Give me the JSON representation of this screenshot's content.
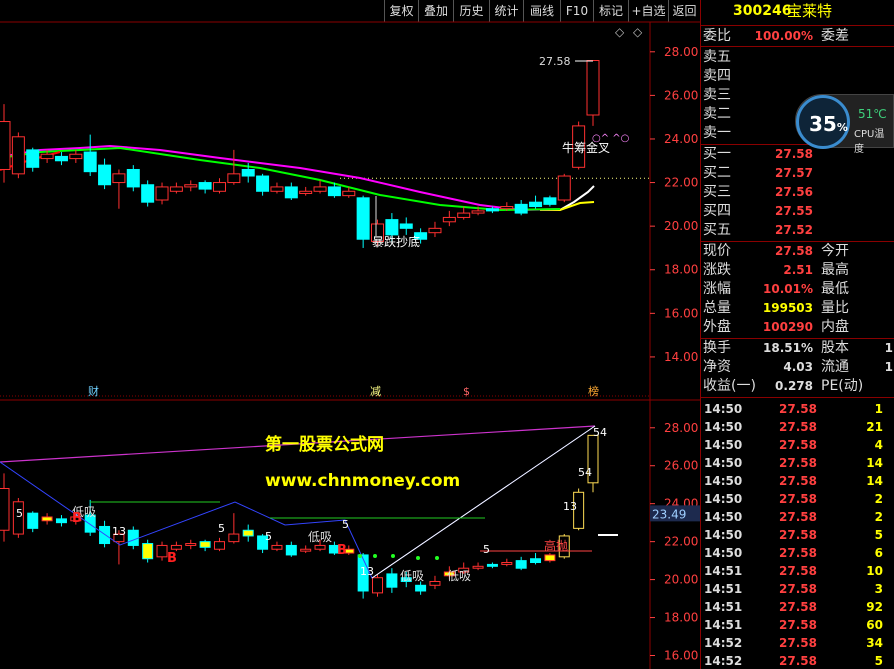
{
  "toolbar": {
    "items": [
      "复权",
      "叠加",
      "历史",
      "统计",
      "画线",
      "F10",
      "标记",
      "+自选",
      "返回"
    ]
  },
  "stock": {
    "code": "300246",
    "name": "宝莱特"
  },
  "colors": {
    "up": "#ff3030",
    "down": "#00ffff",
    "ma5": "#ffffff",
    "ma10": "#ffff00",
    "ma20": "#ff00ff",
    "ma30": "#00ff00",
    "ma60": "#ff0000",
    "axis": "#ff4040",
    "grid": "#8a0000"
  },
  "main_chart": {
    "y_ticks": [
      "28.00",
      "26.00",
      "24.00",
      "22.00",
      "20.00",
      "18.00",
      "16.00",
      "14.00"
    ],
    "ylim": [
      13.4,
      29.0
    ],
    "high_label": "27.58",
    "annotations": [
      "暴跌抄底",
      "牛筹金叉"
    ],
    "pattern_text": "○^ ^○",
    "markers": [
      "财",
      "减",
      "$",
      "榜"
    ]
  },
  "candles": [
    {
      "o": 22.6,
      "c": 24.8,
      "h": 25.6,
      "l": 22.0
    },
    {
      "o": 22.4,
      "c": 24.1,
      "h": 24.3,
      "l": 22.2
    },
    {
      "o": 23.5,
      "c": 22.7,
      "h": 23.6,
      "l": 22.5
    },
    {
      "o": 23.1,
      "c": 23.3,
      "h": 23.5,
      "l": 22.9
    },
    {
      "o": 23.2,
      "c": 23.0,
      "h": 23.4,
      "l": 22.8
    },
    {
      "o": 23.1,
      "c": 23.3,
      "h": 23.5,
      "l": 22.9
    },
    {
      "o": 23.4,
      "c": 22.5,
      "h": 24.2,
      "l": 22.3
    },
    {
      "o": 22.8,
      "c": 21.9,
      "h": 23.1,
      "l": 21.7
    },
    {
      "o": 22.0,
      "c": 22.4,
      "h": 22.6,
      "l": 20.8
    },
    {
      "o": 22.6,
      "c": 21.8,
      "h": 22.8,
      "l": 21.6
    },
    {
      "o": 21.9,
      "c": 21.1,
      "h": 22.1,
      "l": 20.9
    },
    {
      "o": 21.2,
      "c": 21.8,
      "h": 22.0,
      "l": 21.0
    },
    {
      "o": 21.6,
      "c": 21.8,
      "h": 22.0,
      "l": 21.5
    },
    {
      "o": 21.8,
      "c": 21.9,
      "h": 22.1,
      "l": 21.6
    },
    {
      "o": 22.0,
      "c": 21.7,
      "h": 22.1,
      "l": 21.5
    },
    {
      "o": 21.6,
      "c": 22.0,
      "h": 22.2,
      "l": 21.5
    },
    {
      "o": 22.0,
      "c": 22.4,
      "h": 23.5,
      "l": 21.9
    },
    {
      "o": 22.6,
      "c": 22.3,
      "h": 22.9,
      "l": 22.0
    },
    {
      "o": 22.3,
      "c": 21.6,
      "h": 22.4,
      "l": 21.4
    },
    {
      "o": 21.6,
      "c": 21.8,
      "h": 22.0,
      "l": 21.5
    },
    {
      "o": 21.8,
      "c": 21.3,
      "h": 22.0,
      "l": 21.2
    },
    {
      "o": 21.5,
      "c": 21.6,
      "h": 21.8,
      "l": 21.4
    },
    {
      "o": 21.6,
      "c": 21.8,
      "h": 22.1,
      "l": 21.5
    },
    {
      "o": 21.8,
      "c": 21.4,
      "h": 22.0,
      "l": 21.3
    },
    {
      "o": 21.4,
      "c": 21.6,
      "h": 21.8,
      "l": 21.3
    },
    {
      "o": 21.3,
      "c": 19.4,
      "h": 21.4,
      "l": 19.0
    },
    {
      "o": 19.3,
      "c": 20.1,
      "h": 20.3,
      "l": 19.1
    },
    {
      "o": 20.3,
      "c": 19.6,
      "h": 20.6,
      "l": 19.3
    },
    {
      "o": 20.1,
      "c": 19.9,
      "h": 20.4,
      "l": 19.6
    },
    {
      "o": 19.7,
      "c": 19.4,
      "h": 19.9,
      "l": 19.2
    },
    {
      "o": 19.7,
      "c": 19.9,
      "h": 20.2,
      "l": 19.5
    },
    {
      "o": 20.2,
      "c": 20.4,
      "h": 20.7,
      "l": 20.0
    },
    {
      "o": 20.4,
      "c": 20.6,
      "h": 20.9,
      "l": 20.3
    },
    {
      "o": 20.6,
      "c": 20.7,
      "h": 20.9,
      "l": 20.5
    },
    {
      "o": 20.8,
      "c": 20.7,
      "h": 20.9,
      "l": 20.6
    },
    {
      "o": 20.8,
      "c": 20.9,
      "h": 21.1,
      "l": 20.7
    },
    {
      "o": 21.0,
      "c": 20.6,
      "h": 21.2,
      "l": 20.5
    },
    {
      "o": 21.1,
      "c": 20.9,
      "h": 21.4,
      "l": 20.8
    },
    {
      "o": 21.3,
      "c": 21.0,
      "h": 21.4,
      "l": 20.9
    },
    {
      "o": 21.2,
      "c": 22.3,
      "h": 22.4,
      "l": 21.1
    },
    {
      "o": 22.7,
      "c": 24.6,
      "h": 24.8,
      "l": 22.6
    },
    {
      "o": 25.1,
      "c": 27.6,
      "h": 27.6,
      "l": 24.6
    }
  ],
  "ma_lines": {
    "ma5": [
      [
        560,
        210
      ],
      [
        574,
        202
      ],
      [
        588,
        192
      ],
      [
        594,
        186
      ]
    ],
    "ma10": [
      [
        540,
        210
      ],
      [
        560,
        210
      ],
      [
        580,
        203
      ],
      [
        594,
        202
      ]
    ],
    "ma20": [
      [
        0,
        157
      ],
      [
        40,
        150
      ],
      [
        80,
        148
      ],
      [
        110,
        146
      ],
      [
        160,
        150
      ],
      [
        220,
        158
      ],
      [
        300,
        168
      ],
      [
        360,
        178
      ],
      [
        420,
        192
      ],
      [
        480,
        205
      ],
      [
        520,
        210
      ],
      [
        560,
        209
      ]
    ],
    "ma30": [
      [
        0,
        158
      ],
      [
        40,
        152
      ],
      [
        80,
        150
      ],
      [
        120,
        148
      ],
      [
        200,
        160
      ],
      [
        260,
        168
      ],
      [
        320,
        180
      ],
      [
        380,
        195
      ],
      [
        440,
        205
      ],
      [
        500,
        210
      ],
      [
        560,
        209
      ]
    ],
    "ma60": [
      [
        0,
        170
      ],
      [
        30,
        160
      ],
      [
        60,
        152
      ]
    ]
  },
  "sub_chart": {
    "y_ticks": [
      "28.00",
      "26.00",
      "24.00",
      "22.00",
      "20.00",
      "18.00",
      "16.00"
    ],
    "ylim": [
      15.5,
      29.2
    ],
    "price_box": "23.49",
    "watermark": "第一股票公式网",
    "url": "www.chnmoney.com",
    "labels": [
      "低吸",
      "低吸",
      "低吸",
      "低吸",
      "高抛",
      "B",
      "B",
      "B"
    ],
    "numbers": [
      "5",
      "5",
      "5",
      "5",
      "5",
      "13",
      "13",
      "13",
      "54",
      "54"
    ]
  },
  "quote": {
    "weibi_label": "委比",
    "weibi": "100.00%",
    "weicha_label": "委差",
    "sell": [
      {
        "l": "卖五"
      },
      {
        "l": "卖四"
      },
      {
        "l": "卖三"
      },
      {
        "l": "卖二"
      },
      {
        "l": "卖一"
      }
    ],
    "buy": [
      {
        "l": "买一",
        "p": "27.58"
      },
      {
        "l": "买二",
        "p": "27.57"
      },
      {
        "l": "买三",
        "p": "27.56"
      },
      {
        "l": "买四",
        "p": "27.55"
      },
      {
        "l": "买五",
        "p": "27.52"
      }
    ],
    "stats": [
      {
        "l": "现价",
        "v": "27.58",
        "c": "#ff4040",
        "l2": "今开",
        "v2": ""
      },
      {
        "l": "涨跌",
        "v": "2.51",
        "c": "#ff4040",
        "l2": "最高",
        "v2": ""
      },
      {
        "l": "涨幅",
        "v": "10.01%",
        "c": "#ff4040",
        "l2": "最低",
        "v2": ""
      },
      {
        "l": "总量",
        "v": "199503",
        "c": "#ffff00",
        "l2": "量比",
        "v2": ""
      },
      {
        "l": "外盘",
        "v": "100290",
        "c": "#ff4040",
        "l2": "内盘",
        "v2": ""
      }
    ],
    "stats2": [
      {
        "l": "换手",
        "v": "18.51%",
        "c": "#ddd",
        "l2": "股本",
        "v2": "1"
      },
      {
        "l": "净资",
        "v": "4.03",
        "c": "#ddd",
        "l2": "流通",
        "v2": "1"
      },
      {
        "l": "收益(一)",
        "v": "0.278",
        "c": "#ddd",
        "l2": "PE(动)",
        "v2": ""
      }
    ]
  },
  "ticks": [
    {
      "t": "14:50",
      "p": "27.58",
      "v": "1"
    },
    {
      "t": "14:50",
      "p": "27.58",
      "v": "21"
    },
    {
      "t": "14:50",
      "p": "27.58",
      "v": "4"
    },
    {
      "t": "14:50",
      "p": "27.58",
      "v": "14"
    },
    {
      "t": "14:50",
      "p": "27.58",
      "v": "14"
    },
    {
      "t": "14:50",
      "p": "27.58",
      "v": "2"
    },
    {
      "t": "14:50",
      "p": "27.58",
      "v": "2"
    },
    {
      "t": "14:50",
      "p": "27.58",
      "v": "5"
    },
    {
      "t": "14:50",
      "p": "27.58",
      "v": "6"
    },
    {
      "t": "14:51",
      "p": "27.58",
      "v": "10"
    },
    {
      "t": "14:51",
      "p": "27.58",
      "v": "3"
    },
    {
      "t": "14:51",
      "p": "27.58",
      "v": "92"
    },
    {
      "t": "14:51",
      "p": "27.58",
      "v": "60"
    },
    {
      "t": "14:52",
      "p": "27.58",
      "v": "34"
    },
    {
      "t": "14:52",
      "p": "27.58",
      "v": "5"
    }
  ],
  "cpu": {
    "percent": "35",
    "unit": "%",
    "temp": "51℃",
    "label": "CPU温度"
  }
}
